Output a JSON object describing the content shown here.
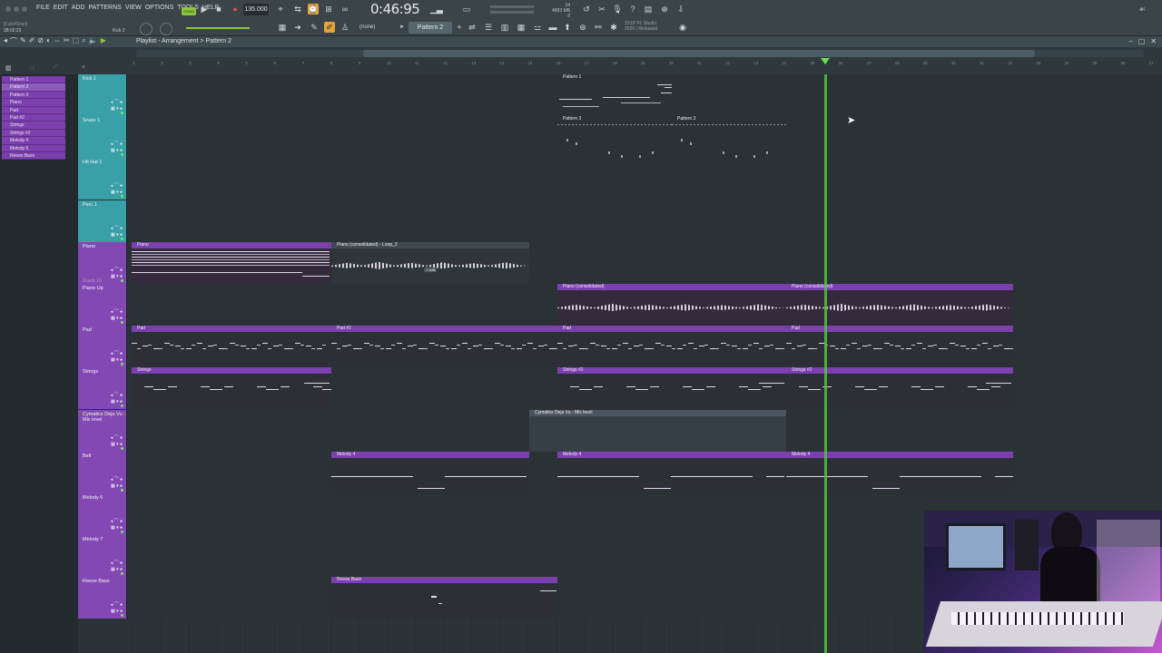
{
  "window": {
    "title": "[FullofShiet]",
    "time_readout": "28:02:23"
  },
  "menu": [
    "FILE",
    "EDIT",
    "ADD",
    "PATTERNS",
    "VIEW",
    "OPTIONS",
    "TOOLS",
    "HELP"
  ],
  "transport": {
    "mode": "SONG",
    "tempo": "135.000",
    "clock": "0:46:95",
    "channel": "Kick 2"
  },
  "memory": {
    "line1": "24",
    "line2": "4883 MB",
    "line3": "8"
  },
  "toolbar": {
    "snap": "(none)",
    "pattern": "Pattern 2",
    "hint_line1": "10:07  FL Studio",
    "hint_line2": "2026 | Released"
  },
  "playlist": {
    "title": "Playlist - Arrangement > Pattern 2"
  },
  "ruler_ticks": [
    "1",
    "2",
    "3",
    "4",
    "5",
    "6",
    "7",
    "8",
    "9",
    "10",
    "11",
    "12",
    "13",
    "14",
    "15",
    "16",
    "17",
    "18",
    "19",
    "20",
    "21",
    "22",
    "23",
    "24",
    "25",
    "26",
    "27",
    "28",
    "29",
    "30",
    "31",
    "32",
    "33",
    "34",
    "35",
    "36",
    "37",
    "38"
  ],
  "picker": [
    "Pattern 1",
    "Pattern 2",
    "Pattern 3",
    "Piano",
    "Pad",
    "Pad #2",
    "Strings",
    "Strings #2",
    "Melody 4",
    "Melody 5",
    "Reese Bass"
  ],
  "tracks": [
    {
      "name": "Kick 1",
      "color": "#3aa0a8"
    },
    {
      "name": "Snare 1",
      "color": "#3aa0a8"
    },
    {
      "name": "Hit Hat 1",
      "color": "#3aa0a8"
    },
    {
      "name": "Perc 1",
      "color": "#3aa0a8"
    },
    {
      "name": "Piano",
      "color": "#8448b5",
      "sub": "Track 10"
    },
    {
      "name": "Piano Up",
      "color": "#8448b5"
    },
    {
      "name": "Pad",
      "color": "#8448b5"
    },
    {
      "name": "Strings",
      "color": "#8448b5"
    },
    {
      "name": "Cymatics Deja Vu - Mix level",
      "color": "#8448b5"
    },
    {
      "name": "Bell",
      "color": "#8448b5"
    },
    {
      "name": "Melody 6",
      "color": "#8448b5"
    },
    {
      "name": "Melody 7",
      "color": "#8448b5"
    },
    {
      "name": "Reese Bass",
      "color": "#8448b5"
    }
  ],
  "clips": {
    "kick_p1": "Pattern 1",
    "kick_p2": "Pattern 2",
    "snare_p3a": "Pattern 3",
    "snare_p3b": "Pattern 3",
    "piano_a": "Piano",
    "piano_b": "Piano (consolidated) - Loop_2",
    "piano_b_db": "7.4dB",
    "pianoup_a": "Piano (consolidated)",
    "pianoup_b": "Piano (consolidated)",
    "pad_a": "Pad",
    "pad_b": "Pad #2",
    "pad_c": "Pad",
    "pad_d": "Pad",
    "str_a": "Strings",
    "str_b": "Strings #2",
    "str_c": "Strings #2",
    "cym": "Cymatics Deja Vu - Mix level",
    "bell_a": "Melody 4",
    "bell_b": "Melody 4",
    "bell_c": "Melody 4",
    "reese": "Reese Bass"
  }
}
